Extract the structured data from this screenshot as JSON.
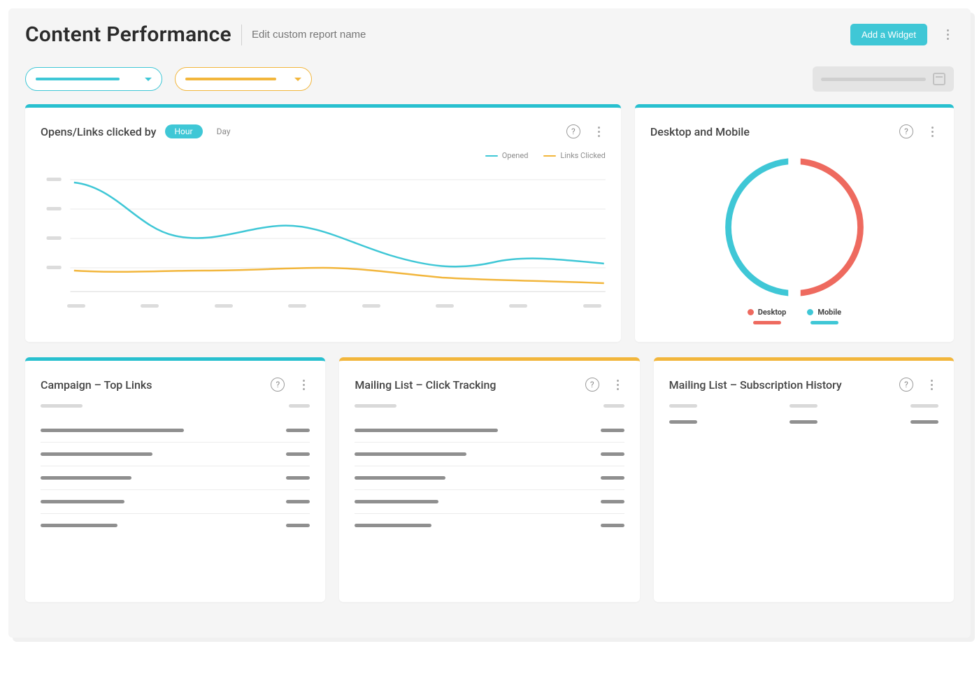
{
  "header": {
    "title": "Content Performance",
    "edit_placeholder": "Edit custom report name",
    "add_widget_label": "Add a Widget"
  },
  "cards": {
    "opens_links": {
      "title": "Opens/Links clicked by",
      "toggles": {
        "hour": "Hour",
        "day": "Day",
        "active": "hour"
      },
      "legend": {
        "opened": "Opened",
        "links_clicked": "Links Clicked"
      }
    },
    "device": {
      "title": "Desktop and Mobile",
      "legend": {
        "desktop": "Desktop",
        "mobile": "Mobile"
      }
    },
    "top_links": {
      "title": "Campaign – Top Links"
    },
    "click_tracking": {
      "title": "Mailing List – Click Tracking"
    },
    "sub_history": {
      "title": "Mailing List – Subscription History"
    }
  },
  "colors": {
    "teal": "#3fc7d6",
    "yellow": "#f2b63c",
    "red": "#ee6a5f"
  },
  "chart_data": [
    {
      "id": "opens_links_line",
      "type": "line",
      "title": "Opens/Links clicked by Hour",
      "x": [
        0,
        1,
        2,
        3,
        4,
        5,
        6,
        7
      ],
      "series": [
        {
          "name": "Opened",
          "color": "#3fc7d6",
          "values": [
            92,
            60,
            48,
            58,
            52,
            38,
            34,
            40,
            42,
            36
          ]
        },
        {
          "name": "Links Clicked",
          "color": "#f2b63c",
          "values": [
            22,
            20,
            22,
            22,
            24,
            24,
            18,
            16,
            15,
            14
          ]
        }
      ],
      "ylim": [
        0,
        100
      ],
      "xlabel": "",
      "ylabel": ""
    },
    {
      "id": "device_donut",
      "type": "pie",
      "title": "Desktop and Mobile",
      "categories": [
        "Desktop",
        "Mobile"
      ],
      "values": [
        50,
        50
      ],
      "colors": [
        "#ee6a5f",
        "#3fc7d6"
      ]
    }
  ]
}
